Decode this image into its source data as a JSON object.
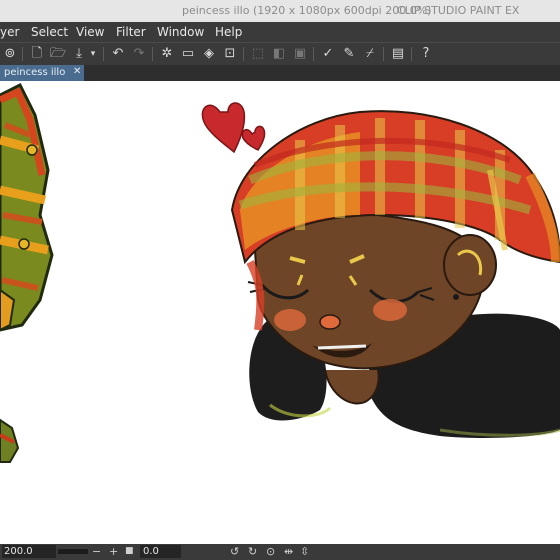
{
  "window": {
    "title": "peincess illo (1920 x 1080px 600dpi 200.0%)",
    "app_name": "CLIP STUDIO PAINT EX"
  },
  "menu": [
    "yer",
    "Select",
    "View",
    "Filter",
    "Window",
    "Help"
  ],
  "toolbar_icons": [
    "layer-icon",
    "new-file-icon",
    "open-folder-icon",
    "save-icon",
    "dropdown-icon",
    "undo-icon",
    "redo-icon",
    "loading-icon",
    "clear-icon",
    "fill-icon",
    "transform-icon",
    "deselect-icon",
    "invert-selection-icon",
    "snap-icon",
    "pen-icon",
    "brush-icon",
    "eraser-icon",
    "panel-icon",
    "help-icon"
  ],
  "tab": {
    "label": "peincess illo",
    "close": "✕"
  },
  "status": {
    "zoom": "200.0",
    "zoom_out": "−",
    "zoom_in": "+",
    "angle": "0.0"
  },
  "colors": {
    "chrome_dark": "#3a3a3a",
    "tab_active": "#4a6c8e",
    "canvas": "#ffffff"
  }
}
